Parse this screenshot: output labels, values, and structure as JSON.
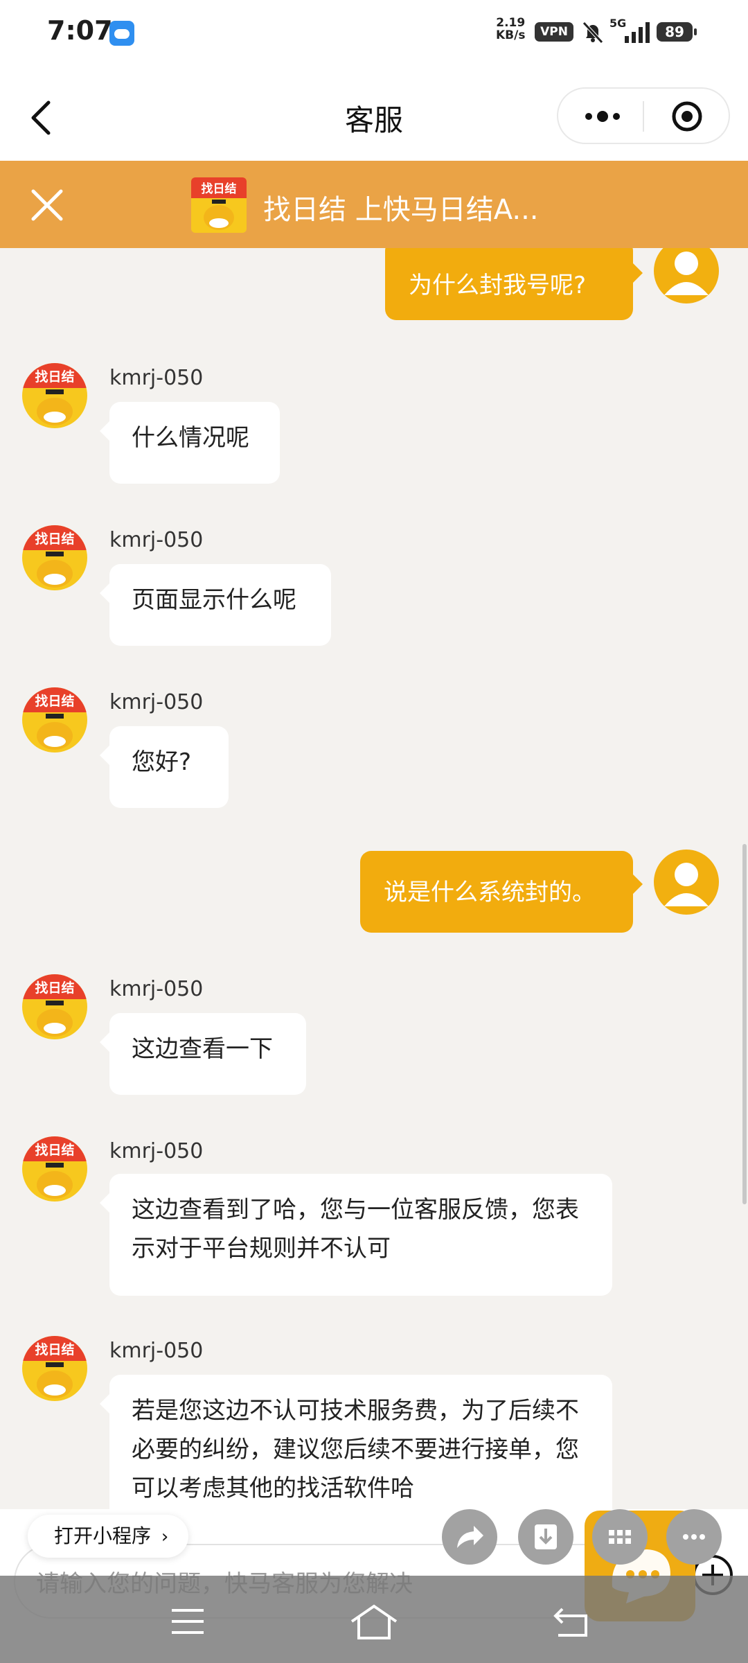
{
  "status_bar": {
    "time": "7:07",
    "speed": "2.19\nKB/s",
    "vpn": "VPN",
    "network": "5G",
    "battery": "89"
  },
  "header": {
    "title": "客服"
  },
  "banner": {
    "logo_text": "找日结",
    "text": "找日结 上快马日结A..."
  },
  "messages": [
    {
      "from": "user",
      "text": "为什么封我号呢?"
    },
    {
      "from": "agent",
      "sender": "kmrj-050",
      "text": "什么情况呢"
    },
    {
      "from": "agent",
      "sender": "kmrj-050",
      "text": "页面显示什么呢"
    },
    {
      "from": "agent",
      "sender": "kmrj-050",
      "text": "您好?"
    },
    {
      "from": "user",
      "text": "说是什么系统封的。"
    },
    {
      "from": "agent",
      "sender": "kmrj-050",
      "text": "这边查看一下"
    },
    {
      "from": "agent",
      "sender": "kmrj-050",
      "text": "这边查看到了哈，您与一位客服反馈，您表示对于平台规则并不认可"
    },
    {
      "from": "agent",
      "sender": "kmrj-050",
      "text": "若是您这边不认可技术服务费，为了后续不必要的纠纷，建议您后续不要进行接单，您可以考虑其他的找活软件哈"
    }
  ],
  "bottom": {
    "open_mini_program": "打开小程序",
    "input_placeholder": "请输入您的问题，快马客服为您解决"
  },
  "colors": {
    "accent": "#f2ac0e",
    "banner": "#eaa346",
    "background": "#f4f2ef"
  }
}
